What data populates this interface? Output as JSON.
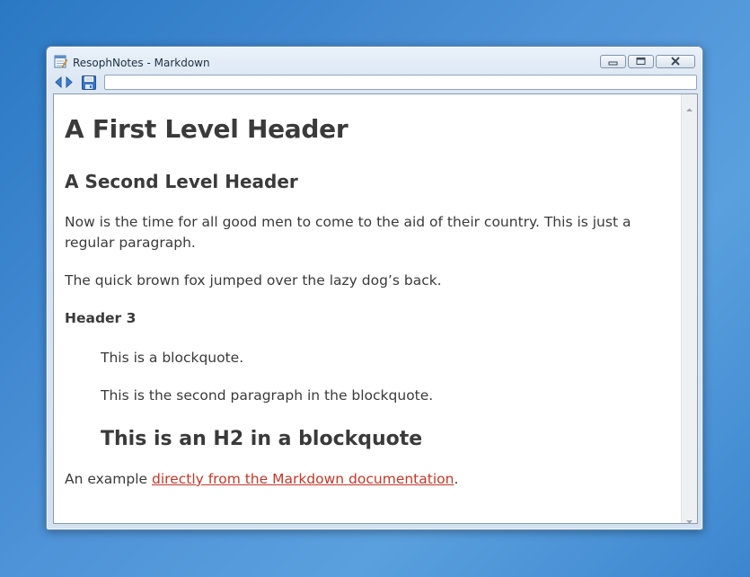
{
  "window": {
    "title": "ResophNotes - Markdown",
    "buttons": {
      "minimize": "minimize-icon",
      "maximize": "maximize-icon",
      "close": "close-icon"
    }
  },
  "toolbar": {
    "back_icon": "back-arrow-icon",
    "forward_icon": "forward-arrow-icon",
    "save_icon": "save-disk-icon",
    "address_value": ""
  },
  "document": {
    "h1": "A First Level Header",
    "h2": "A Second Level Header",
    "paragraph1": "Now is the time for all good men to come to the aid of their country. This is just a regular paragraph.",
    "paragraph2": "The quick brown fox jumped over the lazy dog’s back.",
    "h3": "Header 3",
    "blockquote": {
      "p1": "This is a blockquote.",
      "p2": "This is the second paragraph in the blockquote.",
      "h2": "This is an H2 in a blockquote"
    },
    "example_prefix": "An example ",
    "example_link": "directly from the Markdown documentation",
    "example_suffix": "."
  },
  "colors": {
    "desktop": "#3d86cf",
    "text": "#3a3a3a",
    "link": "#c0392b"
  }
}
